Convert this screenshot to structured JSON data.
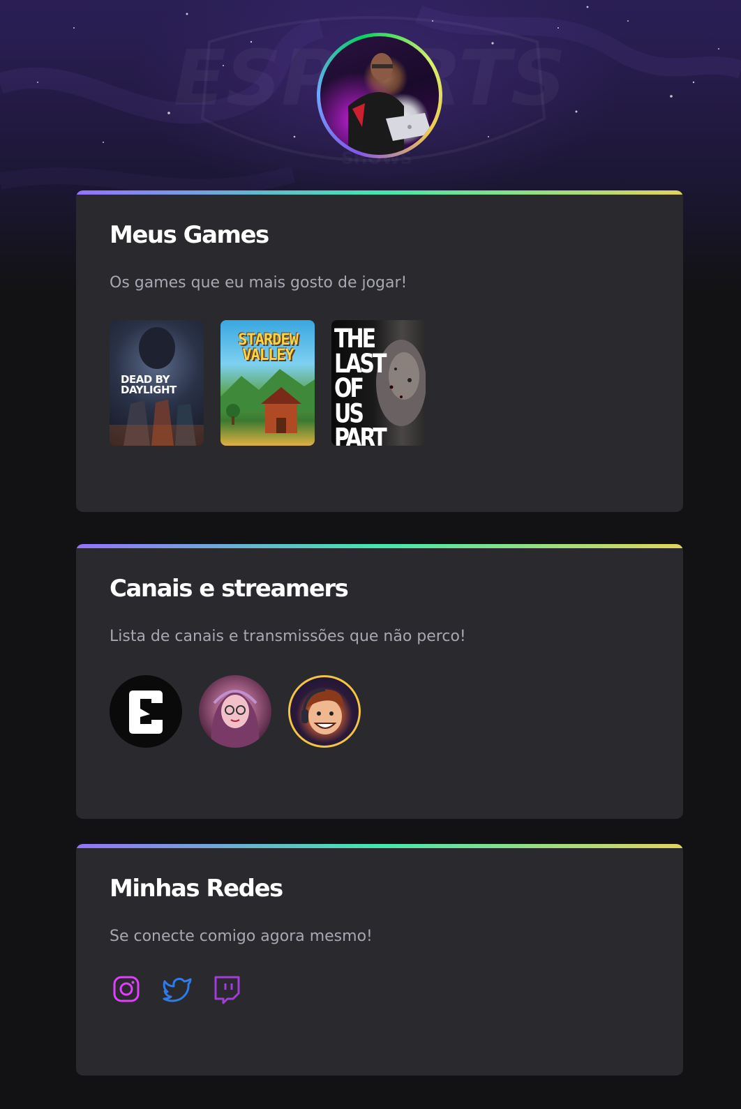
{
  "profile": {
    "avatar_alt": "Foto de perfil"
  },
  "hero": {
    "background_logo_text": "ESPORTS",
    "background_logo_sub": "SHOWS"
  },
  "sections": {
    "games": {
      "title": "Meus Games",
      "description": "Os games que eu mais gosto de jogar!",
      "items": [
        {
          "name": "DEAD BY DAYLIGHT"
        },
        {
          "name": "STARDEW VALLEY"
        },
        {
          "name": "THE LAST OF US PART II"
        }
      ]
    },
    "channels": {
      "title": "Canais e streamers",
      "description": "Lista de canais e transmissões que não perco!"
    },
    "socials": {
      "title": "Minhas Redes",
      "description": "Se conecte comigo agora mesmo!",
      "items": [
        {
          "icon": "instagram-icon",
          "color": "#e040fb"
        },
        {
          "icon": "twitter-icon",
          "color": "#2f7be8"
        },
        {
          "icon": "twitch-icon",
          "color": "#a03fd8"
        }
      ]
    }
  },
  "colors": {
    "page_background": "#121214",
    "card_background": "#29292e",
    "text_primary": "#ffffff",
    "text_secondary": "#a8a8b3",
    "accent_gradient": [
      "#9572fc",
      "#43e7ad",
      "#e2d45c"
    ],
    "channel_ring": "#f5c542"
  }
}
